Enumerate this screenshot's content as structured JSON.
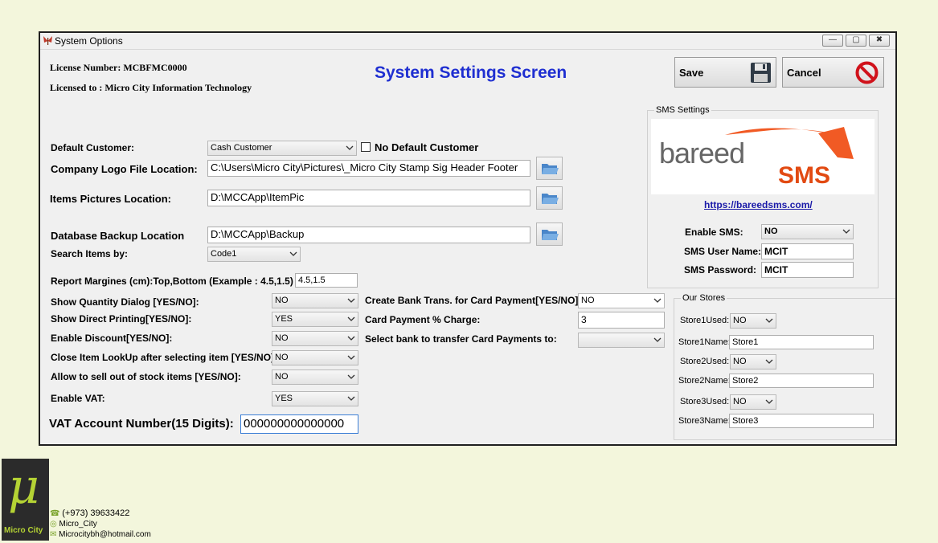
{
  "window": {
    "title": "System Options",
    "minimize": "—",
    "restore": "▢",
    "close": "✖"
  },
  "license": {
    "number_label": "License Number: MCBFMC0000",
    "licensed_to": "Licensed to : Micro City Information Technology"
  },
  "heading": "System Settings Screen",
  "actions": {
    "save": "Save",
    "cancel": "Cancel"
  },
  "form": {
    "default_customer": {
      "label": "Default Customer:",
      "value": "Cash Customer"
    },
    "no_default_customer": {
      "label": "No Default Customer",
      "checked": false
    },
    "company_logo": {
      "label": "Company Logo File Location:",
      "value": "C:\\Users\\Micro City\\Pictures\\_Micro City Stamp Sig Header Footer"
    },
    "items_pictures": {
      "label": "Items Pictures Location:",
      "value": "D:\\MCCApp\\ItemPic"
    },
    "db_backup": {
      "label": "Database Backup Location",
      "value": "D:\\MCCApp\\Backup"
    },
    "search_items": {
      "label": "Search Items by:",
      "value": "Code1"
    },
    "report_margins": {
      "label": "Report Margines (cm):Top,Bottom (Example : 4.5,1.5)",
      "value": "4.5,1.5"
    },
    "show_qty_dialog": {
      "label": "Show Quantity Dialog [YES/NO]:",
      "value": "NO"
    },
    "show_direct_printing": {
      "label": "Show Direct Printing[YES/NO]:",
      "value": "YES"
    },
    "enable_discount": {
      "label": "Enable Discount[YES/NO]:",
      "value": "NO"
    },
    "close_lookup": {
      "label": "Close Item LookUp after selecting item [YES/NO]:",
      "value": "NO"
    },
    "sell_out_of_stock": {
      "label": "Allow to sell out of stock items [YES/NO]:",
      "value": "NO"
    },
    "enable_vat": {
      "label": "Enable VAT:",
      "value": "YES"
    },
    "vat_account": {
      "label": "VAT Account Number(15 Digits):",
      "value": "000000000000000"
    },
    "bank_trans": {
      "label": "Create Bank Trans. for Card Payment[YES/NO]:",
      "value": "NO"
    },
    "card_charge": {
      "label": "Card Payment % Charge:",
      "value": "3"
    },
    "bank_select": {
      "label": "Select bank to transfer Card Payments to:",
      "value": ""
    }
  },
  "sms": {
    "group_title": "SMS Settings",
    "logo_text": "bareed",
    "logo_sms": "SMS",
    "link": "https://bareedsms.com/",
    "enable_label": "Enable SMS:",
    "enable_value": "NO",
    "user_label": "SMS User Name:",
    "user_value": "MCIT",
    "password_label": "SMS Password:",
    "password_value": "MCIT"
  },
  "stores": {
    "group_title": "Our Stores",
    "s1_used_label": "Store1Used:",
    "s1_used": "NO",
    "s1_name_label": "Store1Name:",
    "s1_name": "Store1",
    "s2_used_label": "Store2Used:",
    "s2_used": "NO",
    "s2_name_label": "Store2Name:",
    "s2_name": "Store2",
    "s3_used_label": "Store3Used:",
    "s3_used": "NO",
    "s3_name_label": "Store3Name:",
    "s3_name": "Store3"
  },
  "brand": {
    "logo_letter": "μ",
    "logo_name": "Micro City",
    "phone": "(+973) 39633422",
    "handle": "Micro_City",
    "email": "Microcitybh@hotmail.com"
  },
  "colors": {
    "heading": "#1f2fd1",
    "link": "#1a1aa8",
    "brand_orange": "#f15a24",
    "logo_bg": "#2b2b2b",
    "logo_green": "#b5d334"
  }
}
